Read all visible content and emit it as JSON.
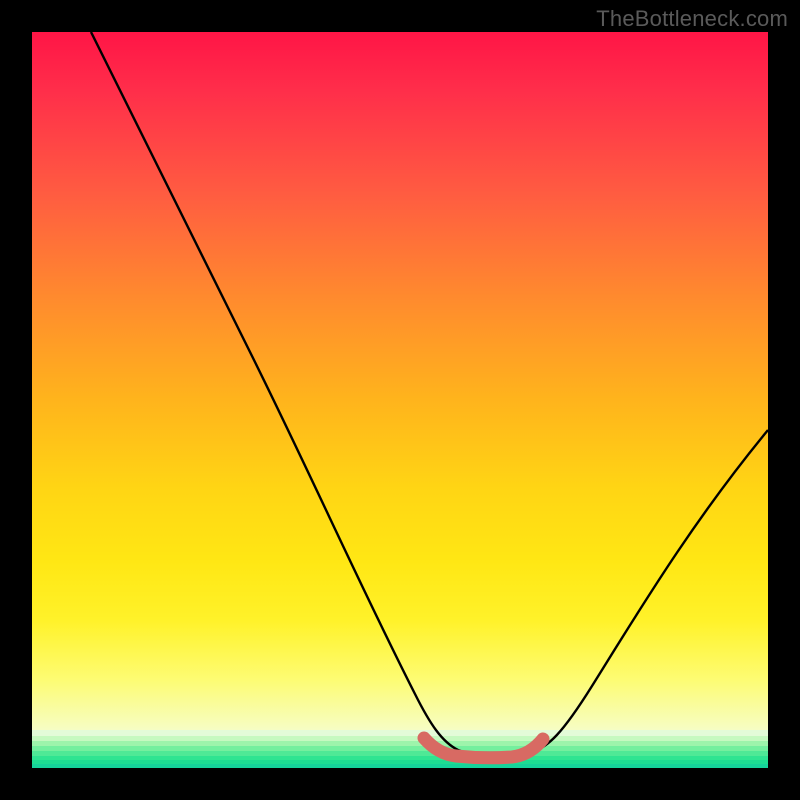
{
  "watermark": "TheBottleneck.com",
  "chart_data": {
    "type": "line",
    "title": "",
    "xlabel": "",
    "ylabel": "",
    "xlim": [
      0,
      100
    ],
    "ylim": [
      0,
      100
    ],
    "grid": false,
    "legend": false,
    "series": [
      {
        "name": "bottleneck-curve",
        "x": [
          8,
          15,
          22,
          30,
          38,
          45,
          52,
          55,
          58,
          62,
          66,
          70,
          76,
          84,
          92,
          100
        ],
        "y": [
          100,
          86,
          72,
          57,
          41,
          26,
          11,
          3,
          0,
          0,
          0,
          2,
          10,
          22,
          34,
          46
        ]
      }
    ],
    "highlight_segment": {
      "name": "flat-minimum",
      "x": [
        54,
        57,
        60,
        63,
        66,
        69
      ],
      "y": [
        3,
        1,
        0,
        0,
        1,
        3
      ],
      "color": "#d86a63"
    },
    "background_gradient": {
      "top": "#ff1546",
      "mid": "#ffd514",
      "bottom": "#27e38a"
    }
  }
}
